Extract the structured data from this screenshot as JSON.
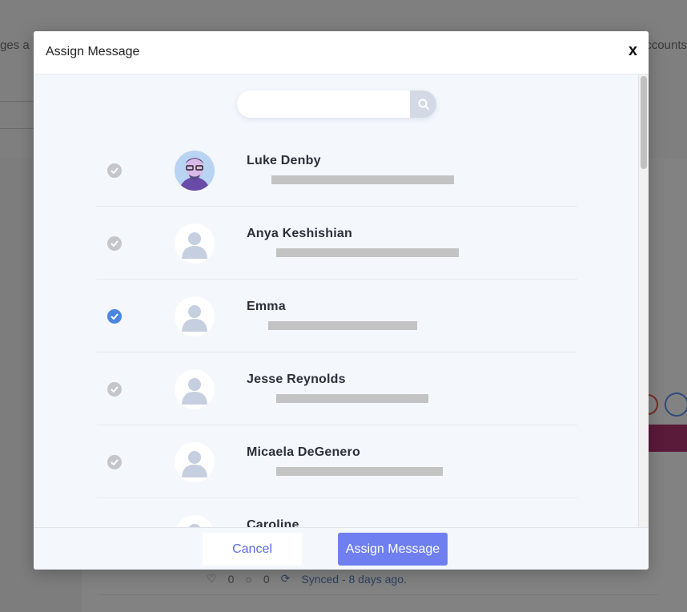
{
  "background": {
    "left_text": "ges a",
    "right_text": "ccounts",
    "stats": {
      "likes": "0",
      "comments": "0",
      "synced": "Synced - 8 days ago."
    }
  },
  "modal": {
    "title": "Assign Message",
    "close_label": "x",
    "search": {
      "placeholder": "",
      "icon": "search-icon"
    },
    "users": [
      {
        "name": "Luke Denby",
        "selected": false,
        "avatar": "photo"
      },
      {
        "name": "Anya Keshishian",
        "selected": false,
        "avatar": "placeholder"
      },
      {
        "name": "Emma",
        "selected": true,
        "avatar": "placeholder"
      },
      {
        "name": "Jesse Reynolds",
        "selected": false,
        "avatar": "placeholder"
      },
      {
        "name": "Micaela DeGenero",
        "selected": false,
        "avatar": "placeholder"
      },
      {
        "name": "Caroline",
        "selected": false,
        "avatar": "placeholder"
      }
    ],
    "footer": {
      "cancel_label": "Cancel",
      "assign_label": "Assign Message"
    }
  },
  "colors": {
    "accent": "#6f7ff0",
    "check_selected": "#4a86e0",
    "check_unselected": "#c4c6c9"
  }
}
